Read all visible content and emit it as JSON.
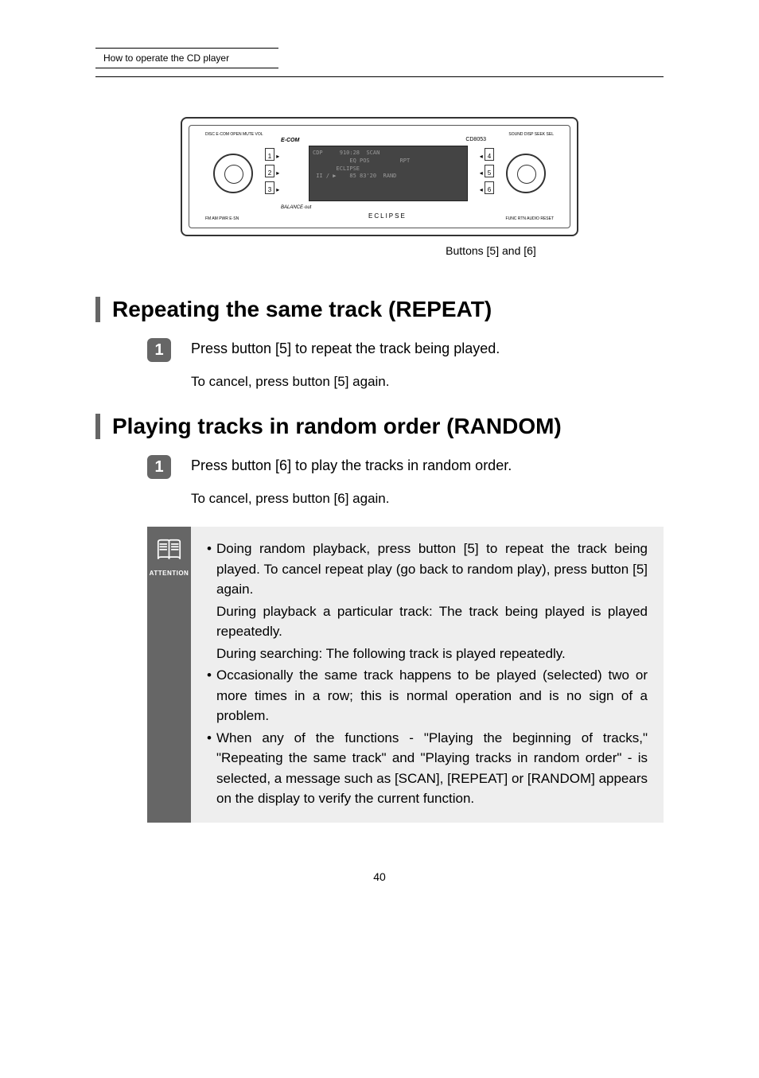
{
  "header": {
    "breadcrumb": "How to operate the CD player"
  },
  "device": {
    "brand_top": "E-COM",
    "model": "CD8053",
    "brand_bottom": "ECLIPSE",
    "balance": "BALANCE·out",
    "lcd": {
      "line1_left": "CDP",
      "line1_mid": "910:28",
      "line1_right": "SCAN",
      "line2_left": "EQ POS",
      "line2_right": "RPT",
      "line3_left": "ECLIPSE",
      "line4_left": "II / ▶",
      "line4_mid": "85   83'20",
      "line4_right": "RAND"
    },
    "buttons_left": [
      "1",
      "2",
      "3"
    ],
    "buttons_right": [
      "4",
      "5",
      "6"
    ],
    "labels": {
      "tl": "DISC  E·COM  OPEN  MUTE  VOL",
      "tr": "SOUND  DISP  SEEK  SEL",
      "bl": "FM  AM  PWR  E·SN",
      "br": "FUNC  RTN  AUDIO  RESET"
    }
  },
  "caption": "Buttons [5] and [6]",
  "section1": {
    "title": "Repeating the same track (REPEAT)",
    "step1": "Press button [5] to repeat the track being played.",
    "sub": "To cancel, press button [5] again."
  },
  "section2": {
    "title": "Playing tracks in random order (RANDOM)",
    "step1": "Press button [6] to play the tracks in random order.",
    "sub": "To cancel, press button [6] again."
  },
  "attention": {
    "label": "ATTENTION",
    "bullets": [
      "Doing random playback, press button [5] to repeat the track being played. To cancel repeat play (go back to random play), press button [5] again.",
      "Occasionally the same track happens to be played (selected) two or more times in a row; this is normal operation and is no sign of a problem.",
      "When any of the functions - \"Playing the beginning of tracks,\" \"Repeating the same track\" and \"Playing tracks in random order\" - is selected, a message such as [SCAN], [REPEAT] or [RANDOM] appears on the display to verify the current function."
    ],
    "indented": [
      "During playback a particular track: The track being played is played repeatedly.",
      "During searching: The following track is played repeatedly."
    ]
  },
  "page_number": "40"
}
